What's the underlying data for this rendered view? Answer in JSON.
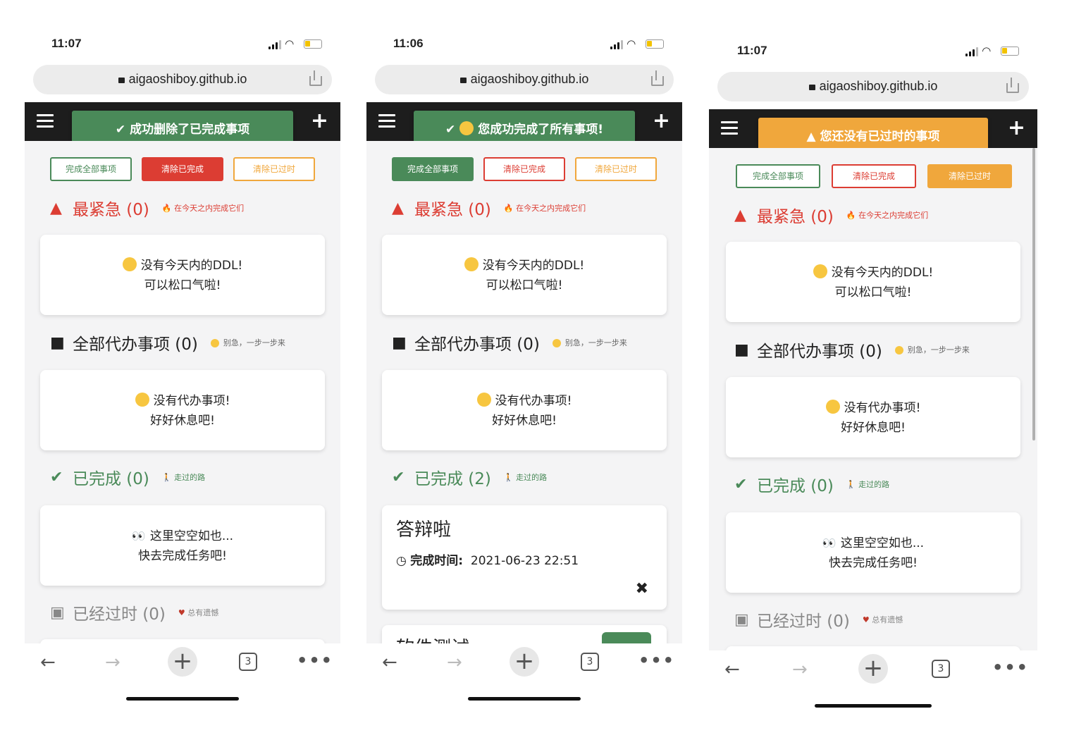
{
  "screens": [
    {
      "time": "11:07",
      "url": "aigaoshiboy.github.io",
      "toast": {
        "text": "成功删除了已完成事项",
        "color": "#4a8a59"
      },
      "buttons": [
        "完成全部事项",
        "清除已完成",
        "清除已过时"
      ],
      "filled_button": 2,
      "urgent": {
        "title": "最紧急 (0)",
        "hint": "在今天之内完成它们",
        "line1": "没有今天内的DDL!",
        "line2": "可以松口气啦!"
      },
      "todo": {
        "title": "全部代办事项 (0)",
        "hint": "别急，一步一步来",
        "line1": "没有代办事项!",
        "line2": "好好休息吧!"
      },
      "done": {
        "title": "已完成 (0)",
        "hint": "走过的路",
        "line1": "这里空空如也...",
        "line2": "快去完成任务吧!"
      },
      "overdue": {
        "title": "已经过时 (0)",
        "hint": "总有遗憾"
      },
      "tab_count": "3"
    },
    {
      "time": "11:06",
      "url": "aigaoshiboy.github.io",
      "toast": {
        "text": "您成功完成了所有事项!",
        "color": "#4a8a59"
      },
      "buttons": [
        "完成全部事项",
        "清除已完成",
        "清除已过时"
      ],
      "filled_button": 1,
      "urgent": {
        "title": "最紧急 (0)",
        "hint": "在今天之内完成它们",
        "line1": "没有今天内的DDL!",
        "line2": "可以松口气啦!"
      },
      "todo": {
        "title": "全部代办事项 (0)",
        "hint": "别急，一步一步来",
        "line1": "没有代办事项!",
        "line2": "好好休息吧!"
      },
      "done": {
        "title": "已完成 (2)",
        "hint": "走过的路"
      },
      "done_task": {
        "title": "答辩啦",
        "label": "完成时间:",
        "value": "2021-06-23 22:51"
      },
      "next_task_title": "软件测试",
      "tab_count": "3"
    },
    {
      "time": "11:07",
      "url": "aigaoshiboy.github.io",
      "toast": {
        "text": "您还没有已过时的事项",
        "color": "#f0a73c"
      },
      "buttons": [
        "完成全部事项",
        "清除已完成",
        "清除已过时"
      ],
      "filled_button": 3,
      "urgent": {
        "title": "最紧急 (0)",
        "hint": "在今天之内完成它们",
        "line1": "没有今天内的DDL!",
        "line2": "可以松口气啦!"
      },
      "todo": {
        "title": "全部代办事项 (0)",
        "hint": "别急，一步一步来",
        "line1": "没有代办事项!",
        "line2": "好好休息吧!"
      },
      "done": {
        "title": "已完成 (0)",
        "hint": "走过的路",
        "line1": "这里空空如也...",
        "line2": "快去完成任务吧!"
      },
      "overdue": {
        "title": "已经过时 (0)",
        "hint": "总有遗憾"
      },
      "tab_count": "3"
    }
  ],
  "colors": {
    "red": "#dc3d33",
    "green": "#4a8a59",
    "orange": "#f0a73c",
    "appbar": "#1d1d1d",
    "content_bg": "#f4f4f5"
  },
  "icons": {
    "menu": "hamburger-icon",
    "add": "plus-icon",
    "urgent": "warning-icon",
    "todo": "note-icon",
    "done": "check-icon",
    "overdue": "calendar-x-icon",
    "time": "clock-icon",
    "delete": "close-icon"
  }
}
